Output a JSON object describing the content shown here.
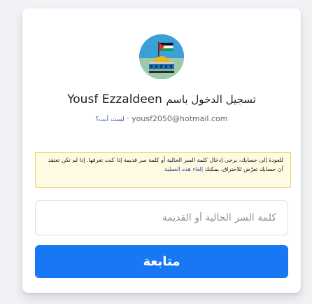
{
  "login": {
    "user_name": "Yousf Ezzaldeen",
    "title_prefix": "تسجيل الدخول باسم",
    "email": "yousf2050@hotmail.com",
    "not_you_link": "لست أنت؟",
    "separator": "·"
  },
  "notice": {
    "text": "للعودة إلى حسابك، يرجى إدخال كلمة السر الحالية أو كلمة سر قديمة إذا كنت تعرفها. إذا لم تكن تعتقد أن حسابك تعرّض للاختراق، يمكنك",
    "cancel_link": "إلغاء هذه العملية"
  },
  "password_field": {
    "placeholder": "كلمة السر الحالية أو القديمة",
    "value": ""
  },
  "continue_button": {
    "label": "متابعة"
  },
  "colors": {
    "button": "#1877f2",
    "link": "#385898",
    "notice_bg": "#fffbe2",
    "notice_border": "#ebd677"
  }
}
